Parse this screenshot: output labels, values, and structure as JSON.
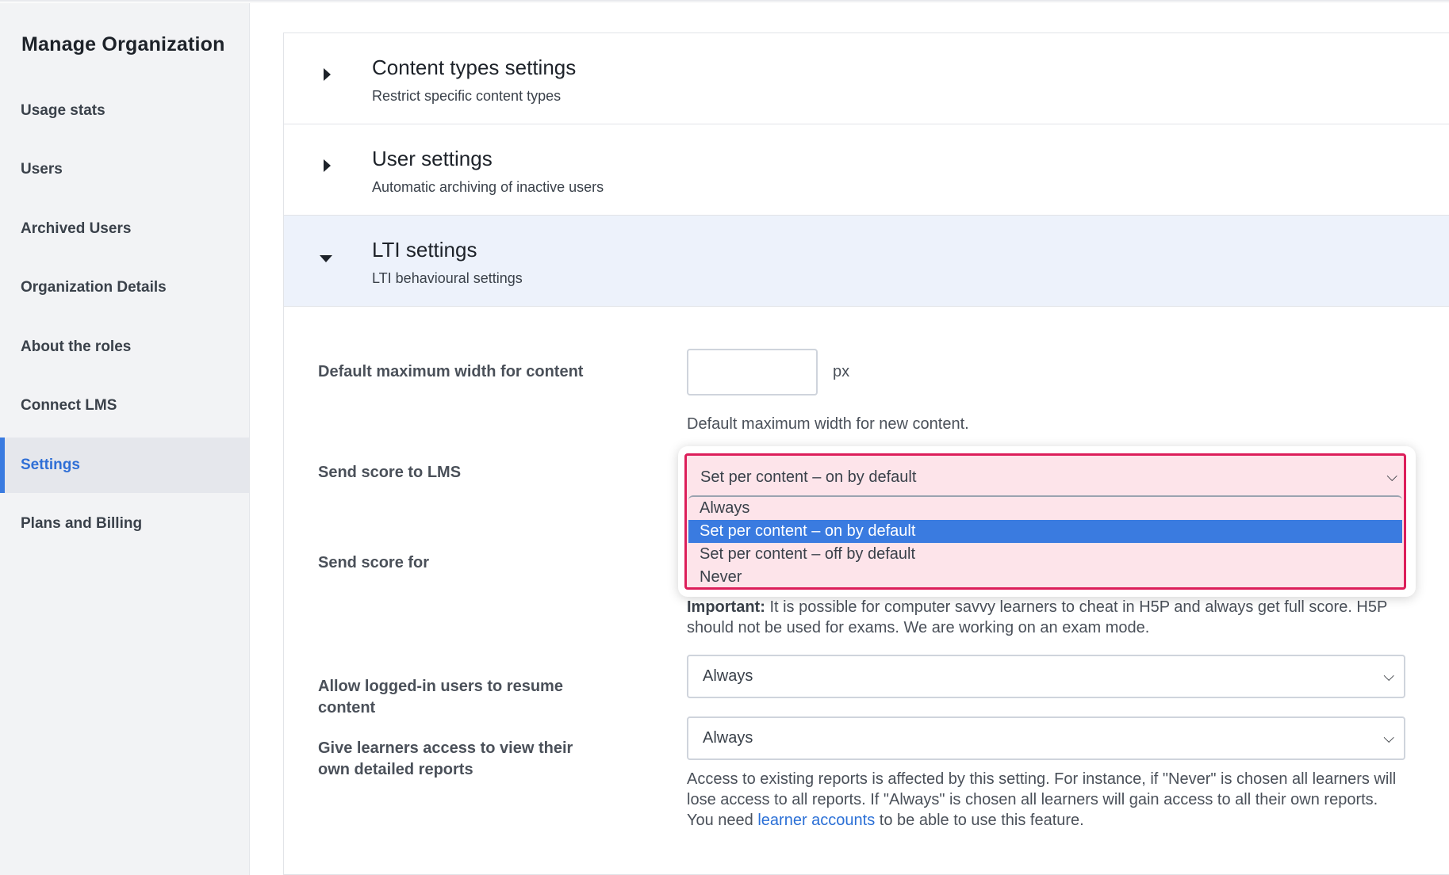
{
  "sidebar": {
    "title": "Manage Organization",
    "items": [
      {
        "label": "Usage stats"
      },
      {
        "label": "Users"
      },
      {
        "label": "Archived Users"
      },
      {
        "label": "Organization Details"
      },
      {
        "label": "About the roles"
      },
      {
        "label": "Connect LMS"
      },
      {
        "label": "Settings",
        "active": true
      },
      {
        "label": "Plans and Billing"
      }
    ]
  },
  "sections": [
    {
      "title": "Content types settings",
      "subtitle": "Restrict specific content types",
      "expanded": false
    },
    {
      "title": "User settings",
      "subtitle": "Automatic archiving of inactive users",
      "expanded": false
    },
    {
      "title": "LTI settings",
      "subtitle": "LTI behavioural settings",
      "expanded": true
    }
  ],
  "lti": {
    "max_width": {
      "label": "Default maximum width for content",
      "value": "",
      "unit": "px",
      "help": "Default maximum width for new content."
    },
    "send_score": {
      "label": "Send score to LMS",
      "selected": "Set per content – on by default",
      "options": [
        "Always",
        "Set per content – on by default",
        "Set per content – off by default",
        "Never"
      ]
    },
    "send_score_for": {
      "label": "Send score for",
      "help_strong": "Important:",
      "help_text": " It is possible for computer savvy learners to cheat in H5P and always get full score. H5P should not be used for exams. We are working on an exam mode."
    },
    "resume": {
      "label": "Allow logged-in users to resume content",
      "selected": "Always"
    },
    "reports": {
      "label": "Give learners access to view their own detailed reports",
      "selected": "Always",
      "help_before": "Access to existing reports is affected by this setting. For instance, if \"Never\" is chosen all learners will lose access to all reports. If \"Always\" is chosen all learners will gain access to all their own reports. You need ",
      "help_link": "learner accounts",
      "help_after": " to be able to use this feature."
    }
  },
  "colors": {
    "accent": "#3a7be0",
    "highlight_border": "#dc1e5a",
    "highlight_fill": "#fde4ea",
    "link": "#2a6fd6"
  }
}
